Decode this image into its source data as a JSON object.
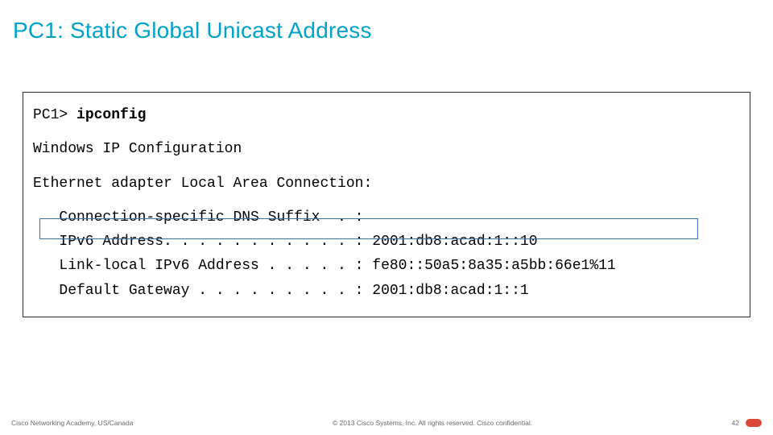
{
  "title": "PC1: Static Global Unicast Address",
  "terminal": {
    "prompt": "PC1> ",
    "command": "ipconfig",
    "header": "Windows IP Configuration",
    "adapter": "Ethernet adapter Local Area Connection:",
    "lines": {
      "dns": "   Connection-specific DNS Suffix  . :",
      "ipv6": "   IPv6 Address. . . . . . . . . . . : 2001:db8:acad:1::10",
      "ll": "   Link-local IPv6 Address . . . . . : fe80::50a5:8a35:a5bb:66e1%11",
      "gw": "   Default Gateway . . . . . . . . . : 2001:db8:acad:1::1"
    }
  },
  "footer": {
    "left": "Cisco Networking Academy, US/Canada",
    "mid": "© 2013 Cisco Systems, Inc. All rights reserved. Cisco confidential.",
    "page": "42"
  }
}
